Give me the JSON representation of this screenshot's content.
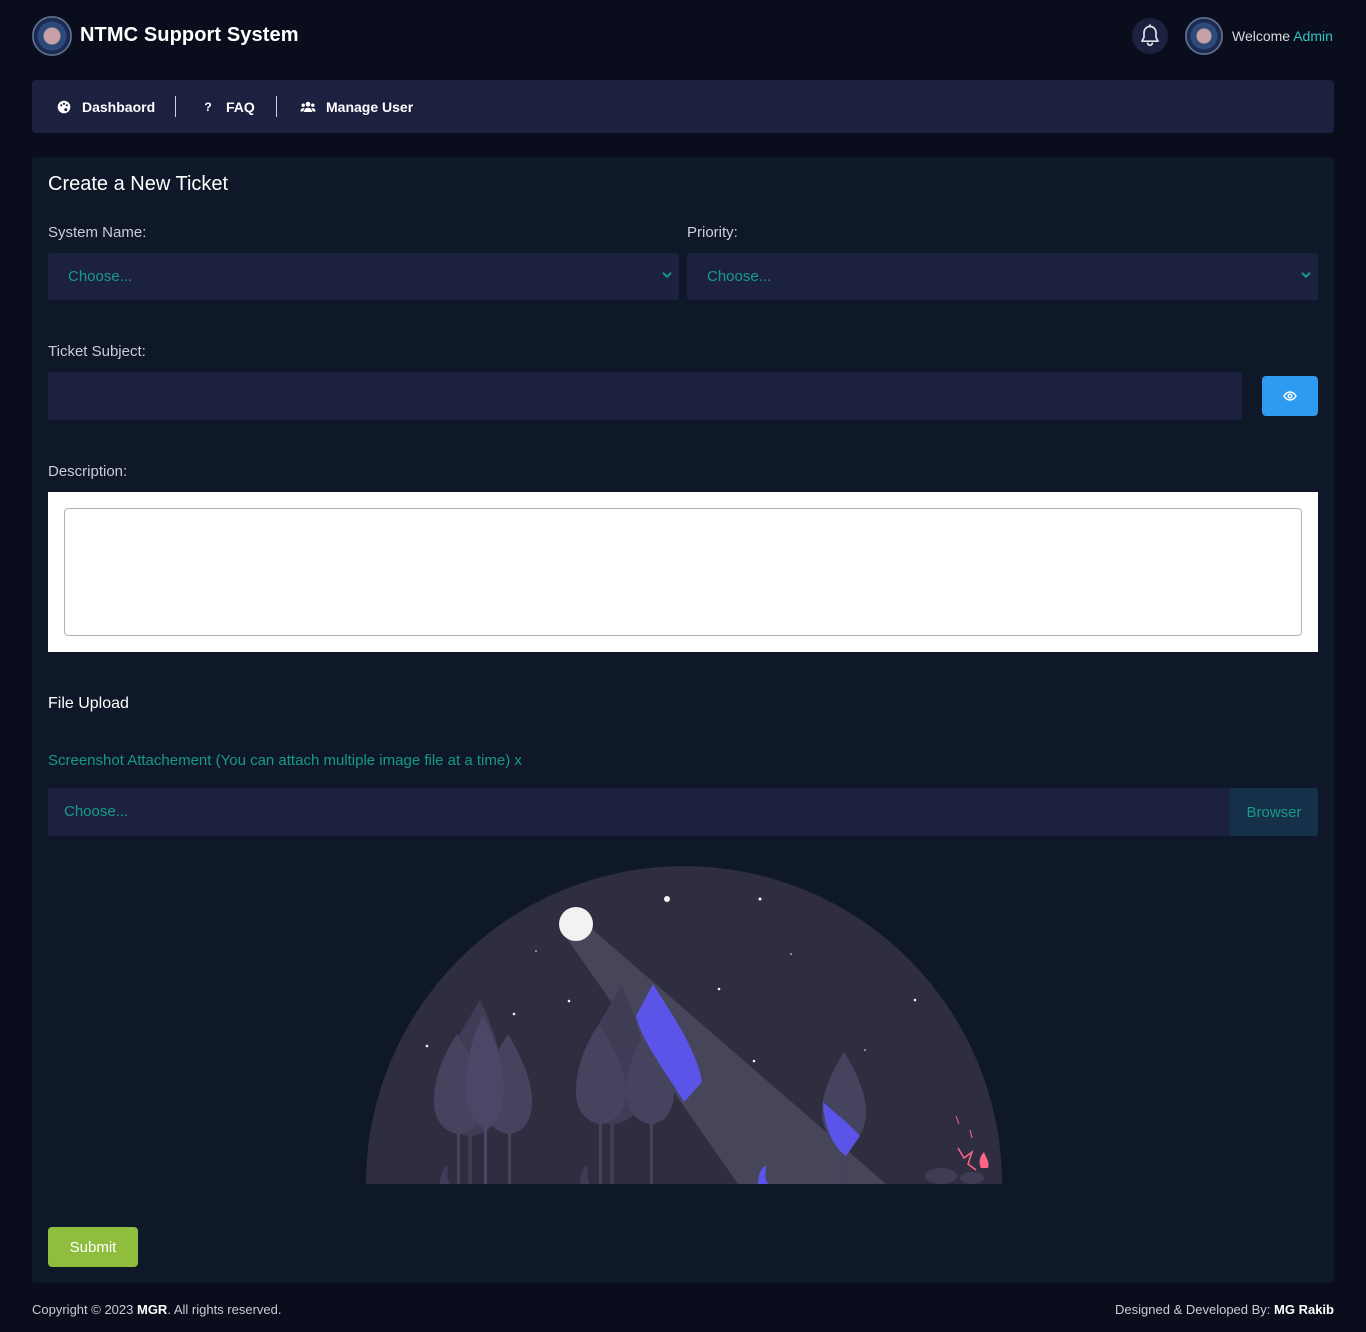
{
  "header": {
    "brand": "NTMC Support System",
    "welcome_label": "Welcome",
    "user_name": "Admin"
  },
  "nav": {
    "items": [
      {
        "label": "Dashbaord",
        "icon": "palette-icon"
      },
      {
        "label": "FAQ",
        "icon": "question-icon"
      },
      {
        "label": "Manage User",
        "icon": "users-icon"
      }
    ]
  },
  "form": {
    "title": "Create a New Ticket",
    "system_name_label": "System Name:",
    "system_name_value": "Choose...",
    "priority_label": "Priority:",
    "priority_value": "Choose...",
    "subject_label": "Ticket Subject:",
    "subject_value": "",
    "description_label": "Description:",
    "description_value": "",
    "file_section_title": "File Upload",
    "file_hint": "Screenshot Attachement (You can attach multiple image file at a time) x",
    "file_placeholder": "Choose...",
    "browse_label": "Browser",
    "submit_label": "Submit"
  },
  "footer": {
    "copyright_prefix": "Copyright © 2023",
    "copyright_owner": "MGR",
    "copyright_suffix": ". All rights reserved.",
    "credit_prefix": "Designed & Developed By:",
    "credit_name": "MG Rakib"
  },
  "colors": {
    "background": "#0a0e1c",
    "panel": "#0f1828",
    "field": "#1d2140",
    "accent_teal": "#169b86",
    "eye_button": "#2f9bf0",
    "submit_button": "#8fbe3e"
  }
}
